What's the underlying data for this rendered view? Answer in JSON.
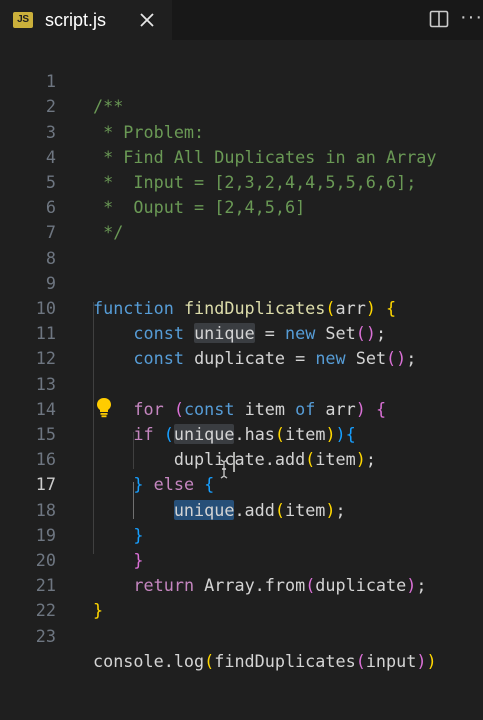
{
  "tab": {
    "icon_text": "JS",
    "filename": "script.js",
    "icon_color": "#cbb03b"
  },
  "editor": {
    "active_line": 17,
    "lines": [
      {
        "n": "1",
        "text": "/**"
      },
      {
        "n": "2",
        "text": " * Problem:"
      },
      {
        "n": "3",
        "text": " * Find All Duplicates in an Array"
      },
      {
        "n": "4",
        "text": " *  Input = [2,3,2,4,4,5,5,6,6];"
      },
      {
        "n": "5",
        "text": " *  Ouput = [2,4,5,6]"
      },
      {
        "n": "6",
        "text": " */"
      },
      {
        "n": "7",
        "text": ""
      },
      {
        "n": "8",
        "text": ""
      },
      {
        "n": "9",
        "text": "function findDuplicates(arr) {"
      },
      {
        "n": "10",
        "text": "    const unique = new Set();"
      },
      {
        "n": "11",
        "text": "    const duplicate = new Set();"
      },
      {
        "n": "12",
        "text": ""
      },
      {
        "n": "13",
        "text": "    for (const item of arr) {"
      },
      {
        "n": "14",
        "text": "    if (unique.has(item)){"
      },
      {
        "n": "15",
        "text": "        duplicate.add(item);"
      },
      {
        "n": "16",
        "text": "    } else {"
      },
      {
        "n": "17",
        "text": "        unique.add(item);"
      },
      {
        "n": "18",
        "text": "    }"
      },
      {
        "n": "19",
        "text": "    }"
      },
      {
        "n": "20",
        "text": "    return Array.from(duplicate);"
      },
      {
        "n": "21",
        "text": "}"
      },
      {
        "n": "22",
        "text": ""
      },
      {
        "n": "23",
        "text": "console.log(findDuplicates(input))"
      }
    ]
  },
  "colors": {
    "background": "#1f1f1f",
    "comment": "#6a9955",
    "keyword": "#569cd6",
    "control": "#c586c0",
    "function": "#dcdcaa",
    "selection": "#264f78"
  }
}
